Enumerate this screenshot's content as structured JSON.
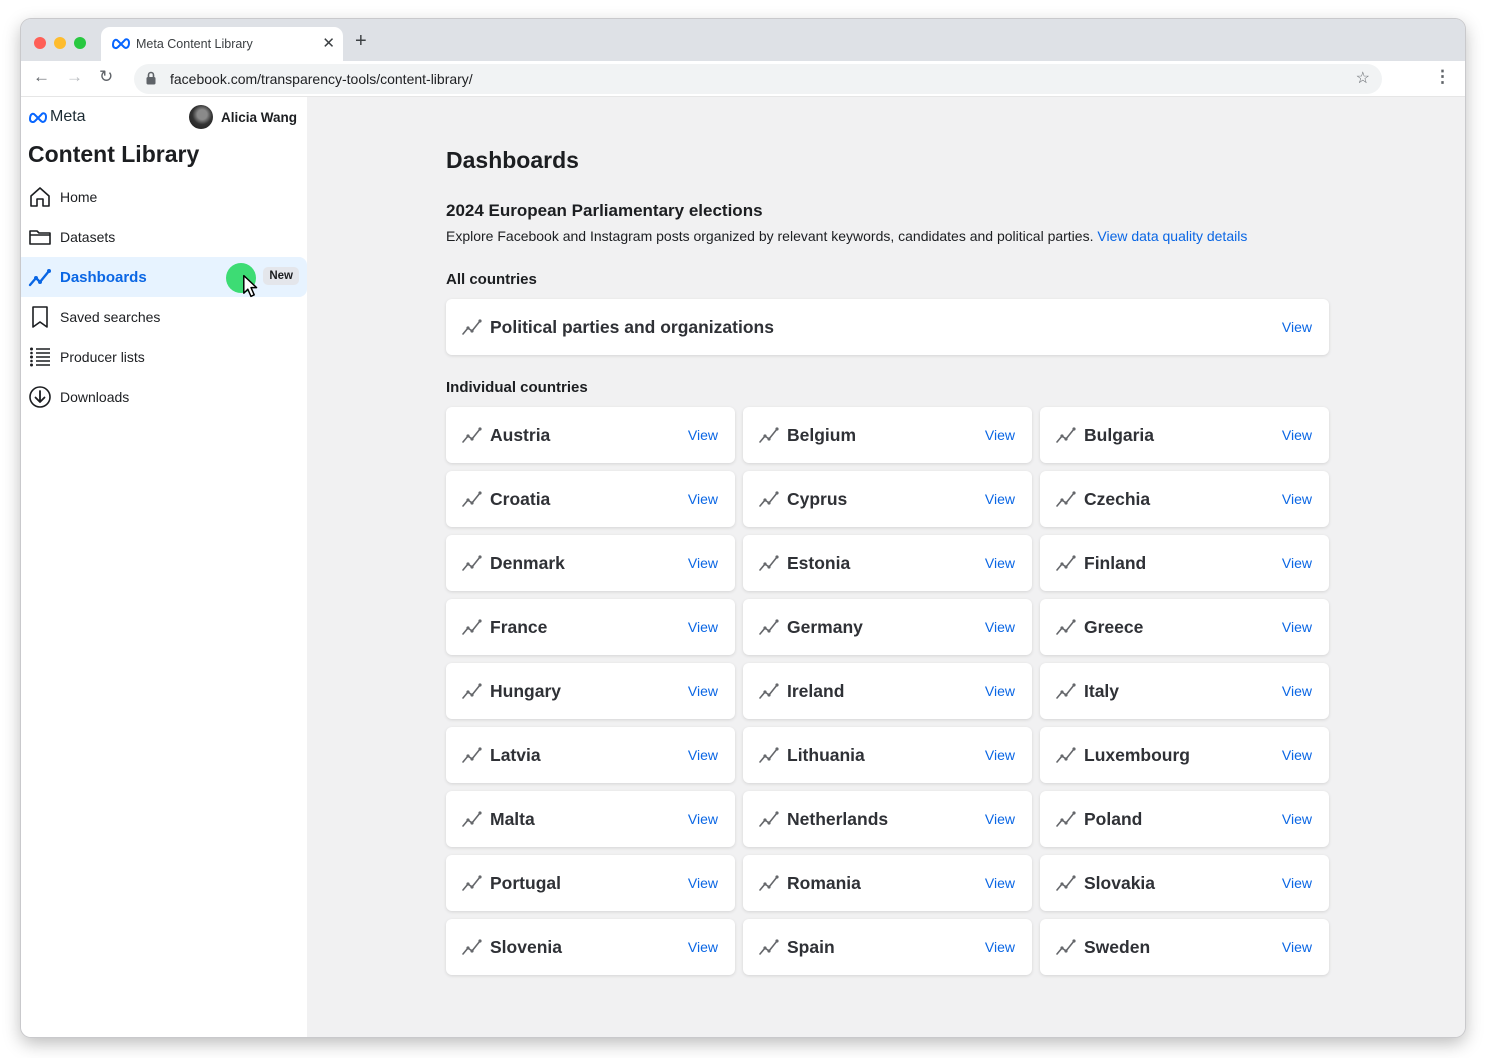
{
  "browser": {
    "tab_title": "Meta Content Library",
    "new_tab_symbol": "+",
    "url": "facebook.com/transparency-tools/content-library/"
  },
  "sidebar": {
    "brand": "Meta",
    "user_name": "Alicia Wang",
    "title": "Content Library",
    "items": [
      {
        "label": "Home",
        "icon": "home-icon"
      },
      {
        "label": "Datasets",
        "icon": "folder-icon"
      },
      {
        "label": "Dashboards",
        "icon": "dashboard-chart-icon",
        "badge": "New",
        "active": true
      },
      {
        "label": "Saved searches",
        "icon": "bookmark-icon"
      },
      {
        "label": "Producer lists",
        "icon": "list-icon"
      },
      {
        "label": "Downloads",
        "icon": "download-icon"
      }
    ]
  },
  "main": {
    "page_title": "Dashboards",
    "section_title": "2024 European Parliamentary elections",
    "section_desc": "Explore Facebook and Instagram posts organized by relevant keywords, candidates and political parties.",
    "section_link": "View data quality details",
    "all_countries_heading": "All countries",
    "all_countries_card": {
      "label": "Political parties and organizations",
      "action": "View"
    },
    "individual_heading": "Individual countries",
    "view_label": "View",
    "countries": [
      "Austria",
      "Belgium",
      "Bulgaria",
      "Croatia",
      "Cyprus",
      "Czechia",
      "Denmark",
      "Estonia",
      "Finland",
      "France",
      "Germany",
      "Greece",
      "Hungary",
      "Ireland",
      "Italy",
      "Latvia",
      "Lithuania",
      "Luxembourg",
      "Malta",
      "Netherlands",
      "Poland",
      "Portugal",
      "Romania",
      "Slovakia",
      "Slovenia",
      "Spain",
      "Sweden"
    ]
  },
  "colors": {
    "accent": "#0a66e4",
    "active_bg": "#e7f3ff",
    "click_indicator": "#3ddc74"
  }
}
